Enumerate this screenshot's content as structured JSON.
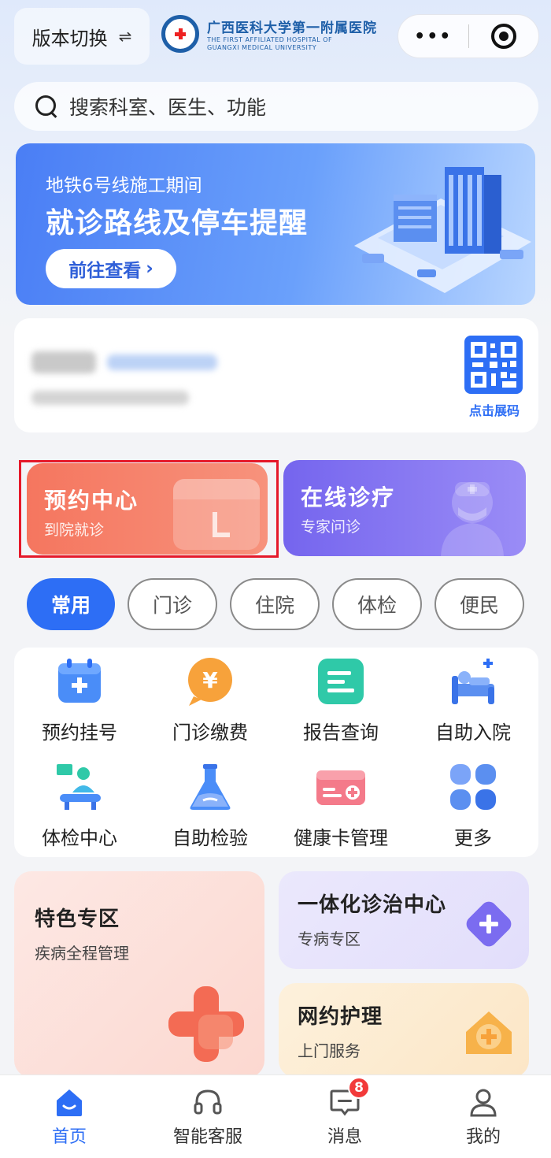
{
  "top_bar": {
    "version_label": "版本切换",
    "swap_glyph": "⇌",
    "logo_cn": "广西医科大学第一附属医院",
    "logo_en_1": "THE FIRST AFFILIATED HOSPITAL OF",
    "logo_en_2": "GUANGXI MEDICAL UNIVERSITY",
    "more_glyph": "•••"
  },
  "search": {
    "placeholder": "搜索科室、医生、功能"
  },
  "banner": {
    "subtitle": "地铁6号线施工期间",
    "title": "就诊路线及停车提醒",
    "button_label": "前往查看",
    "button_arrow": "›"
  },
  "patient_card": {
    "qr_label": "点击展码"
  },
  "primary_tiles": [
    {
      "title": "预约中心",
      "subtitle": "到院就诊"
    },
    {
      "title": "在线诊疗",
      "subtitle": "专家问诊"
    }
  ],
  "category_tabs": [
    {
      "label": "常用",
      "active": true
    },
    {
      "label": "门诊",
      "active": false
    },
    {
      "label": "住院",
      "active": false
    },
    {
      "label": "体检",
      "active": false
    },
    {
      "label": "便民",
      "active": false
    }
  ],
  "functions": [
    {
      "label": "预约挂号",
      "icon": "register-icon"
    },
    {
      "label": "门诊缴费",
      "icon": "payment-icon"
    },
    {
      "label": "报告查询",
      "icon": "report-icon"
    },
    {
      "label": "自助入院",
      "icon": "admission-icon"
    },
    {
      "label": "体检中心",
      "icon": "checkup-icon"
    },
    {
      "label": "自助检验",
      "icon": "lab-test-icon"
    },
    {
      "label": "健康卡管理",
      "icon": "health-card-icon"
    },
    {
      "label": "更多",
      "icon": "more-grid-icon"
    }
  ],
  "features": {
    "special": {
      "title": "特色专区",
      "subtitle": "疾病全程管理"
    },
    "integrated": {
      "title": "一体化诊治中心",
      "subtitle": "专病专区"
    },
    "nursing": {
      "title": "网约护理",
      "subtitle": "上门服务"
    }
  },
  "bottom_nav": [
    {
      "label": "首页",
      "active": true
    },
    {
      "label": "智能客服",
      "active": false
    },
    {
      "label": "消息",
      "active": false,
      "badge": "8"
    },
    {
      "label": "我的",
      "active": false
    }
  ],
  "colors": {
    "accent": "#2d6ef5",
    "appointment_tile": "#f5765f",
    "online_tile": "#7565ee",
    "badge": "#f23a3a"
  }
}
